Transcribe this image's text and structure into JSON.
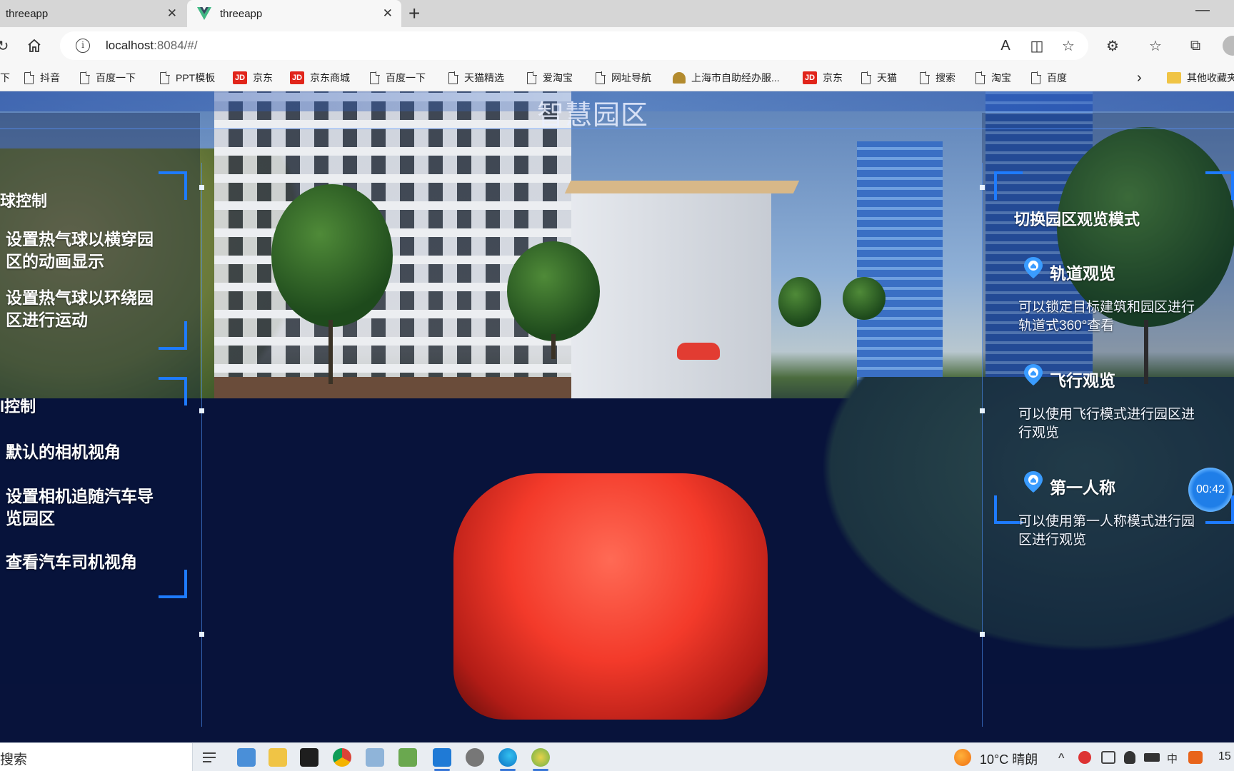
{
  "browser": {
    "tabs": [
      {
        "title": "threeapp",
        "active": false
      },
      {
        "title": "threeapp",
        "active": true
      }
    ],
    "url_host": "localhost",
    "url_rest": ":8084/#/",
    "bookmarks": [
      {
        "label": "下",
        "icon": "page-icon"
      },
      {
        "label": "抖音",
        "icon": "page-icon"
      },
      {
        "label": "百度一下",
        "icon": "page-icon"
      },
      {
        "label": "PPT模板",
        "icon": "page-icon"
      },
      {
        "label": "京东",
        "icon": "jd-icon"
      },
      {
        "label": "京东商城",
        "icon": "jd-icon"
      },
      {
        "label": "百度一下",
        "icon": "page-icon"
      },
      {
        "label": "天猫精选",
        "icon": "page-icon"
      },
      {
        "label": "爱淘宝",
        "icon": "page-icon"
      },
      {
        "label": "网址导航",
        "icon": "page-icon"
      },
      {
        "label": "上海市自助经办服...",
        "icon": "gov-icon"
      },
      {
        "label": "京东",
        "icon": "jd-icon"
      },
      {
        "label": "天猫",
        "icon": "page-icon"
      },
      {
        "label": "搜索",
        "icon": "page-icon"
      },
      {
        "label": "淘宝",
        "icon": "page-icon"
      },
      {
        "label": "百度",
        "icon": "page-icon"
      }
    ],
    "other_bookmarks": "其他收藏夹"
  },
  "scene": {
    "title": "智慧园区",
    "left_panel": {
      "group1_title": "球控制",
      "group1_items": [
        "设置热气球以横穿园区的动画显示",
        "设置热气球以环绕园区进行运动"
      ],
      "group1_item1_lines": [
        "设置热气球以横穿园",
        "区的动画显示"
      ],
      "group1_item2_lines": [
        "设置热气球以环绕园",
        "区进行运动"
      ],
      "group2_title": "l控制",
      "group2_item1": "默认的相机视角",
      "group2_item2_lines": [
        "设置相机追随汽车导",
        "览园区"
      ],
      "group2_item3": "查看汽车司机视角"
    },
    "right_panel": {
      "title": "切换园区观览模式",
      "modes": [
        {
          "title": "轨道观览",
          "desc_lines": [
            "可以锁定目标建筑和园区进行",
            "轨道式360°查看"
          ]
        },
        {
          "title": "飞行观览",
          "desc_lines": [
            "可以使用飞行模式进行园区进",
            "行观览"
          ]
        },
        {
          "title": "第一人称",
          "desc_lines": [
            "可以使用第一人称模式进行园",
            "区进行观览"
          ]
        }
      ]
    },
    "timer": "00:42"
  },
  "taskbar": {
    "search": "搜索",
    "weather": "10°C  晴朗",
    "ime": "中",
    "clock": "15"
  },
  "colors": {
    "accent": "#1e7bff",
    "road": "#08133b",
    "car": "#f33a2a"
  }
}
